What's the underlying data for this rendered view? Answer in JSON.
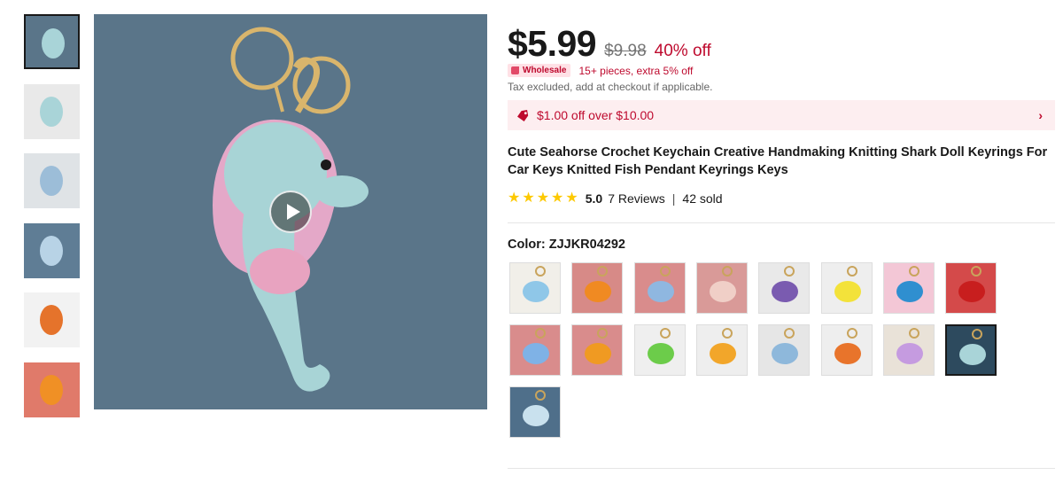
{
  "gallery": {
    "thumbnails": [
      {
        "alt": "seahorse",
        "bg": "#5a7589",
        "fg": "#a9d4d8",
        "active": true
      },
      {
        "alt": "shark in hand",
        "bg": "#e9e9e9",
        "fg": "#a9d4d8"
      },
      {
        "alt": "shark held",
        "bg": "#dfe3e6",
        "fg": "#9cbdd8"
      },
      {
        "alt": "shark on blue",
        "bg": "#5f7d95",
        "fg": "#b8d3e6"
      },
      {
        "alt": "shrimp",
        "bg": "#f2f2f2",
        "fg": "#e5732b"
      },
      {
        "alt": "clownfish",
        "bg": "#e07a6a",
        "fg": "#f09025"
      }
    ],
    "main_video": {
      "background": "#5a7589"
    }
  },
  "price": {
    "current": "$5.99",
    "original": "$9.98",
    "discount": "40% off"
  },
  "wholesale": {
    "badge": "Wholesale",
    "text": "15+ pieces, extra 5% off"
  },
  "tax_note": "Tax excluded, add at checkout if applicable.",
  "coupon": {
    "text": "$1.00 off over $10.00",
    "chevron": "›"
  },
  "product": {
    "title": "Cute Seahorse Crochet Keychain Creative Handmaking Knitting Shark Doll Keyrings For Car Keys Knitted Fish Pendant Keyrings Keys"
  },
  "rating": {
    "stars": 5,
    "score": "5.0",
    "reviews": "7 Reviews",
    "separator": "|",
    "sold": "42 sold"
  },
  "color": {
    "label": "Color: ZJJKR04292",
    "swatches": [
      {
        "bg": "#f1efe9",
        "fg": "#8fc7e8"
      },
      {
        "bg": "#d78a87",
        "fg": "#f08a22"
      },
      {
        "bg": "#d98c8c",
        "fg": "#8fb7e0"
      },
      {
        "bg": "#d99a98",
        "fg": "#f0cfc7"
      },
      {
        "bg": "#e9e9e9",
        "fg": "#7a5bb0"
      },
      {
        "bg": "#eeeeee",
        "fg": "#f3e23a"
      },
      {
        "bg": "#f3c7d6",
        "fg": "#2f8fd0"
      },
      {
        "bg": "#d44a4a",
        "fg": "#c81e1e"
      },
      {
        "bg": "#d98c8c",
        "fg": "#7fb2e6"
      },
      {
        "bg": "#d98c8c",
        "fg": "#f09a22"
      },
      {
        "bg": "#efefef",
        "fg": "#6ccc4a"
      },
      {
        "bg": "#eeeeee",
        "fg": "#f2a62a"
      },
      {
        "bg": "#e6e6e6",
        "fg": "#8eb8db"
      },
      {
        "bg": "#eeeeee",
        "fg": "#e8742b"
      },
      {
        "bg": "#e9e2d8",
        "fg": "#c59be0"
      },
      {
        "bg": "#2d4a5e",
        "fg": "#a9d4d8",
        "selected": true
      },
      {
        "bg": "#4f6f8a",
        "fg": "#c9e1ee"
      }
    ]
  }
}
